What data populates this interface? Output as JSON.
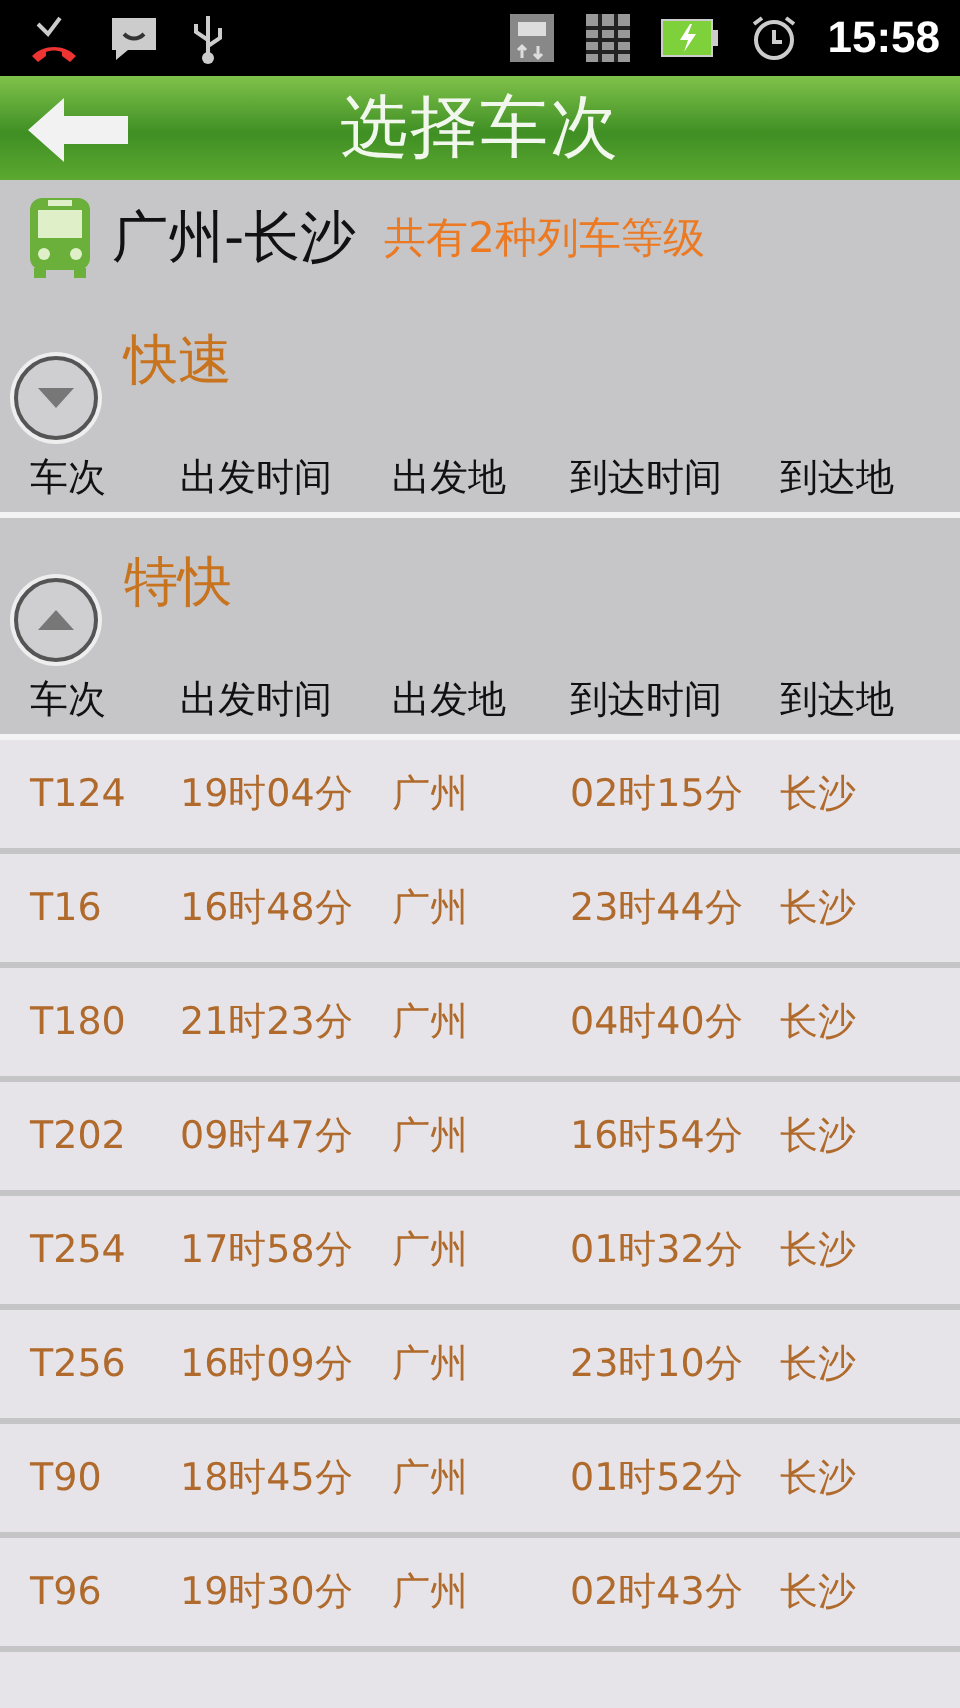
{
  "status_bar": {
    "time": "15:58"
  },
  "header": {
    "title": "选择车次"
  },
  "route": {
    "name": "广州-长沙",
    "summary": "共有2种列车等级"
  },
  "groups": [
    {
      "title": "快速",
      "expanded": false,
      "columns": [
        "车次",
        "出发时间",
        "出发地",
        "到达时间",
        "到达地"
      ]
    },
    {
      "title": "特快",
      "expanded": true,
      "columns": [
        "车次",
        "出发时间",
        "出发地",
        "到达时间",
        "到达地"
      ],
      "rows": [
        [
          "T124",
          "19时04分",
          "广州",
          "02时15分",
          "长沙"
        ],
        [
          "T16",
          "16时48分",
          "广州",
          "23时44分",
          "长沙"
        ],
        [
          "T180",
          "21时23分",
          "广州",
          "04时40分",
          "长沙"
        ],
        [
          "T202",
          "09时47分",
          "广州",
          "16时54分",
          "长沙"
        ],
        [
          "T254",
          "17时58分",
          "广州",
          "01时32分",
          "长沙"
        ],
        [
          "T256",
          "16时09分",
          "广州",
          "23时10分",
          "长沙"
        ],
        [
          "T90",
          "18时45分",
          "广州",
          "01时52分",
          "长沙"
        ],
        [
          "T96",
          "19时30分",
          "广州",
          "02时43分",
          "长沙"
        ]
      ]
    }
  ]
}
